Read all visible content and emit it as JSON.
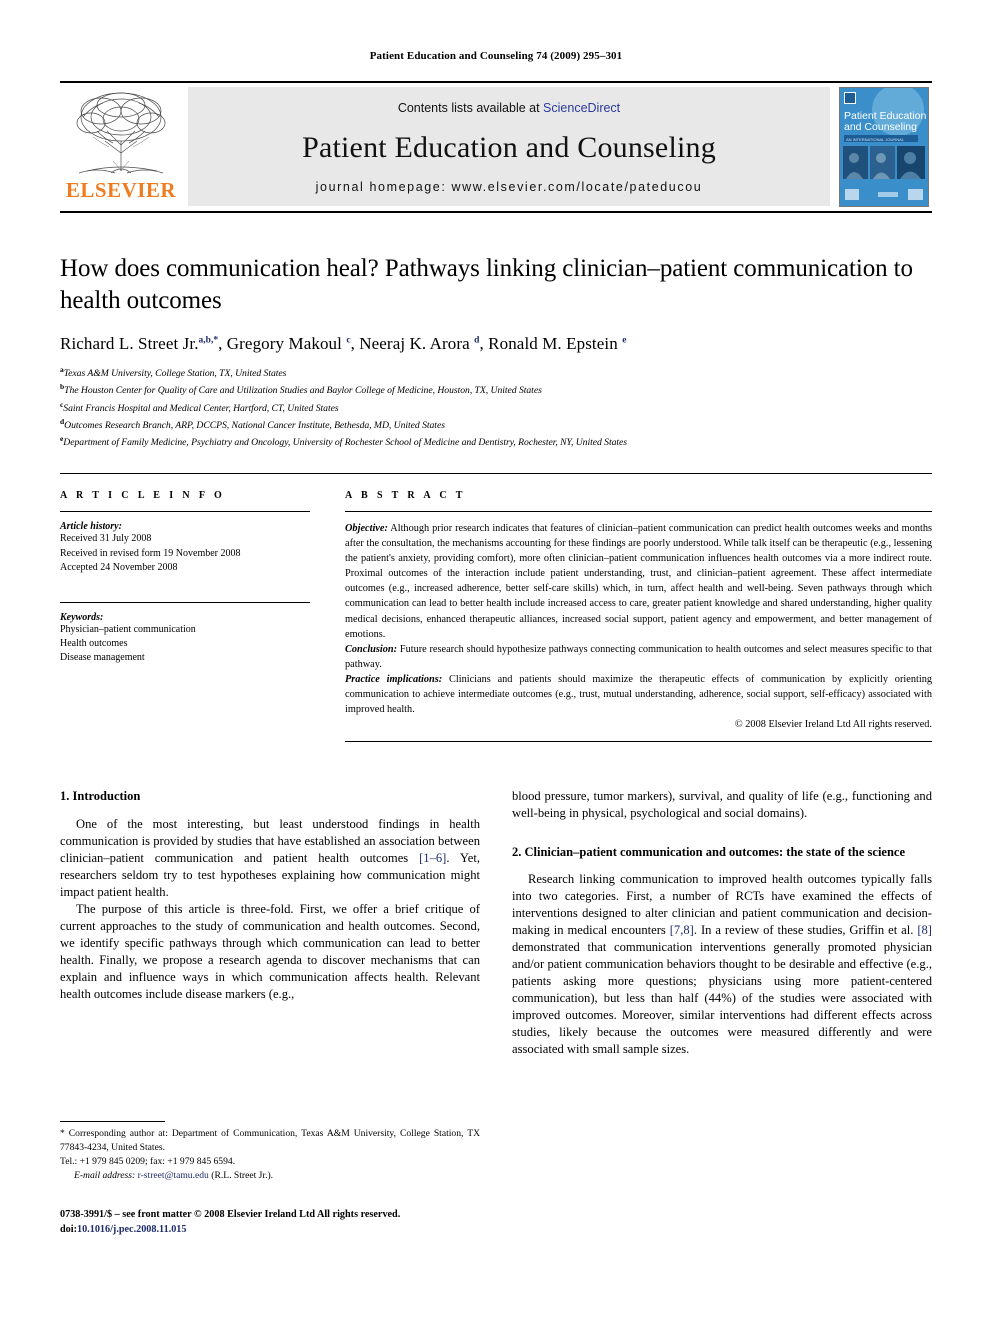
{
  "running_head": "Patient Education and Counseling 74 (2009) 295–301",
  "banner": {
    "publisher_name": "ELSEVIER",
    "contents_prefix": "Contents lists available at ",
    "contents_link": "ScienceDirect",
    "journal_title": "Patient Education and Counseling",
    "homepage": "journal homepage: www.elsevier.com/locate/pateducou",
    "cover_title_line1": "Patient Education",
    "cover_title_line2": "and Counseling"
  },
  "article": {
    "title": "How does communication heal? Pathways linking clinician–patient communication to health outcomes",
    "authors": [
      {
        "name": "Richard L. Street Jr.",
        "sup": "a,b,*"
      },
      {
        "name": "Gregory Makoul",
        "sup": "c"
      },
      {
        "name": "Neeraj K. Arora",
        "sup": "d"
      },
      {
        "name": "Ronald M. Epstein",
        "sup": "e"
      }
    ],
    "affiliations": [
      {
        "marker": "a",
        "text": "Texas A&M University, College Station, TX, United States"
      },
      {
        "marker": "b",
        "text": "The Houston Center for Quality of Care and Utilization Studies and Baylor College of Medicine, Houston, TX, United States"
      },
      {
        "marker": "c",
        "text": "Saint Francis Hospital and Medical Center, Hartford, CT, United States"
      },
      {
        "marker": "d",
        "text": "Outcomes Research Branch, ARP, DCCPS, National Cancer Institute, Bethesda, MD, United States"
      },
      {
        "marker": "e",
        "text": "Department of Family Medicine, Psychiatry and Oncology, University of Rochester School of Medicine and Dentistry, Rochester, NY, United States"
      }
    ]
  },
  "article_info": {
    "heading": "A R T I C L E   I N F O",
    "history_label": "Article history:",
    "history": [
      "Received 31 July 2008",
      "Received in revised form 19 November 2008",
      "Accepted 24 November 2008"
    ],
    "keywords_label": "Keywords:",
    "keywords": [
      "Physician–patient communication",
      "Health outcomes",
      "Disease management"
    ]
  },
  "abstract": {
    "heading": "A B S T R A C T",
    "objective_label": "Objective:",
    "objective_text": " Although prior research indicates that features of clinician–patient communication can predict health outcomes weeks and months after the consultation, the mechanisms accounting for these findings are poorly understood. While talk itself can be therapeutic (e.g., lessening the patient's anxiety, providing comfort), more often clinician–patient communication influences health outcomes via a more indirect route. Proximal outcomes of the interaction include patient understanding, trust, and clinician–patient agreement. These affect intermediate outcomes (e.g., increased adherence, better self-care skills) which, in turn, affect health and well-being. Seven pathways through which communication can lead to better health include increased access to care, greater patient knowledge and shared understanding, higher quality medical decisions, enhanced therapeutic alliances, increased social support, patient agency and empowerment, and better management of emotions.",
    "conclusion_label": "Conclusion:",
    "conclusion_text": " Future research should hypothesize pathways connecting communication to health outcomes and select measures specific to that pathway.",
    "implications_label": "Practice implications:",
    "implications_text": " Clinicians and patients should maximize the therapeutic effects of communication by explicitly orienting communication to achieve intermediate outcomes (e.g., trust, mutual understanding, adherence, social support, self-efficacy) associated with improved health.",
    "copyright": "© 2008 Elsevier Ireland Ltd All rights reserved."
  },
  "body": {
    "left": {
      "section1_heading": "1. Introduction",
      "para1_a": "One of the most interesting, but least understood findings in health communication is provided by studies that have established an association between clinician–patient communication and patient health outcomes ",
      "para1_ref": "[1–6]",
      "para1_b": ". Yet, researchers seldom try to test hypotheses explaining how communication might impact patient health.",
      "para2": "The purpose of this article is three-fold. First, we offer a brief critique of current approaches to the study of communication and health outcomes. Second, we identify specific pathways through which communication can lead to better health. Finally, we propose a research agenda to discover mechanisms that can explain and influence ways in which communication affects health. Relevant health outcomes include disease markers (e.g.,"
    },
    "right": {
      "para_cont": "blood pressure, tumor markers), survival, and quality of life (e.g., functioning and well-being in physical, psychological and social domains).",
      "section2_heading": "2. Clinician–patient communication and outcomes: the state of the science",
      "para3_a": "Research linking communication to improved health outcomes typically falls into two categories. First, a number of RCTs have examined the effects of interventions designed to alter clinician and patient communication and decision-making in medical encounters ",
      "para3_ref1": "[7,8]",
      "para3_b": ". In a review of these studies, Griffin et al. ",
      "para3_ref2": "[8]",
      "para3_c": " demonstrated that communication interventions generally promoted physician and/or patient communication behaviors thought to be desirable and effective (e.g., patients asking more questions; physicians using more patient-centered communication), but less than half (44%) of the studies were associated with improved outcomes. Moreover, similar interventions had different effects across studies, likely because the outcomes were measured differently and were associated with small sample sizes."
    }
  },
  "footnote": {
    "corresponding_star": "*",
    "corresponding_text": " Corresponding author at: Department of Communication, Texas A&M University, College Station, TX 77843-4234, United States.",
    "contact_line": "Tel.: +1 979 845 0209; fax: +1 979 845 6594.",
    "email_label": "E-mail address:",
    "email": "r-street@tamu.edu",
    "email_suffix": " (R.L. Street Jr.)."
  },
  "imprint": {
    "line1": "0738-3991/$ – see front matter © 2008 Elsevier Ireland Ltd All rights reserved.",
    "doi_prefix": "doi:",
    "doi": "10.1016/j.pec.2008.11.015"
  }
}
